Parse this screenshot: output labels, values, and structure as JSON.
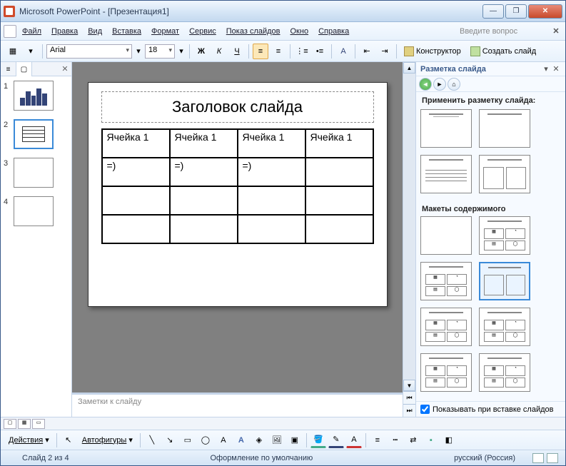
{
  "window": {
    "title": "Microsoft PowerPoint - [Презентация1]"
  },
  "win_buttons": {
    "min": "__",
    "max": "▢",
    "close": "✕"
  },
  "menu": {
    "file": "Файл",
    "edit": "Правка",
    "view": "Вид",
    "insert": "Вставка",
    "format": "Формат",
    "tools": "Сервис",
    "slideshow": "Показ слайдов",
    "window": "Окно",
    "help": "Справка",
    "question": "Введите вопрос"
  },
  "toolbar": {
    "font": "Arial",
    "size": "18",
    "bold": "Ж",
    "italic": "К",
    "underline": "Ч",
    "designer": "Конструктор",
    "new_slide": "Создать слайд"
  },
  "thumbnails": [
    {
      "num": "1"
    },
    {
      "num": "2"
    },
    {
      "num": "3"
    },
    {
      "num": "4"
    }
  ],
  "slide": {
    "title": "Заголовок слайда",
    "table": {
      "rows": [
        [
          "Ячейка 1",
          "Ячейка 1",
          "Ячейка 1",
          "Ячейка 1"
        ],
        [
          "=)",
          "=)",
          "=)",
          ""
        ],
        [
          "",
          "",
          "",
          ""
        ],
        [
          "",
          "",
          "",
          ""
        ]
      ]
    }
  },
  "notes": {
    "placeholder": "Заметки к слайду"
  },
  "task_pane": {
    "title": "Разметка слайда",
    "apply_label": "Применить разметку слайда:",
    "content_label": "Макеты содержимого",
    "show_on_insert": "Показывать при вставке слайдов"
  },
  "drawing_toolbar": {
    "actions": "Действия",
    "autoshapes": "Автофигуры"
  },
  "statusbar": {
    "slide_info": "Слайд 2 из 4",
    "design": "Оформление по умолчанию",
    "language": "русский (Россия)"
  }
}
